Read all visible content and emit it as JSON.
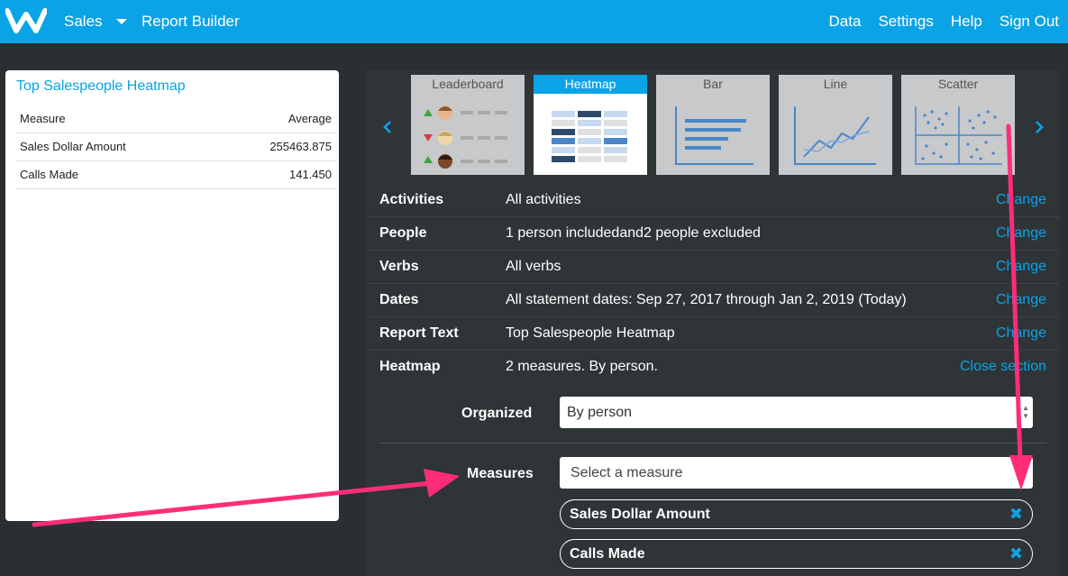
{
  "nav": {
    "logo": "W",
    "sales": "Sales",
    "report_builder": "Report Builder",
    "right": [
      "Data",
      "Settings",
      "Help",
      "Sign Out"
    ]
  },
  "preview": {
    "title": "Top Salespeople Heatmap",
    "columns": [
      "Measure",
      "Average"
    ],
    "rows": [
      {
        "measure": "Sales Dollar Amount",
        "average": "255463.875"
      },
      {
        "measure": "Calls Made",
        "average": "141.450"
      }
    ]
  },
  "report_types": [
    "Leaderboard",
    "Heatmap",
    "Bar",
    "Line",
    "Scatter"
  ],
  "selected_type": "Heatmap",
  "settings": [
    {
      "label": "Activities",
      "value": "All activities",
      "action": "Change"
    },
    {
      "label": "People",
      "value": "1 person includedand2 people excluded",
      "action": "Change"
    },
    {
      "label": "Verbs",
      "value": "All verbs",
      "action": "Change"
    },
    {
      "label": "Dates",
      "value": "All statement dates: Sep 27, 2017 through Jan 2, 2019 (Today)",
      "action": "Change"
    },
    {
      "label": "Report Text",
      "value": "Top Salespeople Heatmap",
      "action": "Change"
    },
    {
      "label": "Heatmap",
      "value": "2 measures. By person.",
      "action": "Close section"
    }
  ],
  "heatmap_section": {
    "organized_label": "Organized",
    "organized_value": "By person",
    "measures_label": "Measures",
    "measures_placeholder": "Select a measure",
    "selected_measures": [
      "Sales Dollar Amount",
      "Calls Made"
    ]
  },
  "colors": {
    "accent": "#0aa3e6",
    "annotation_arrow": "#ff2d78",
    "panel_bg": "#2f3437"
  }
}
